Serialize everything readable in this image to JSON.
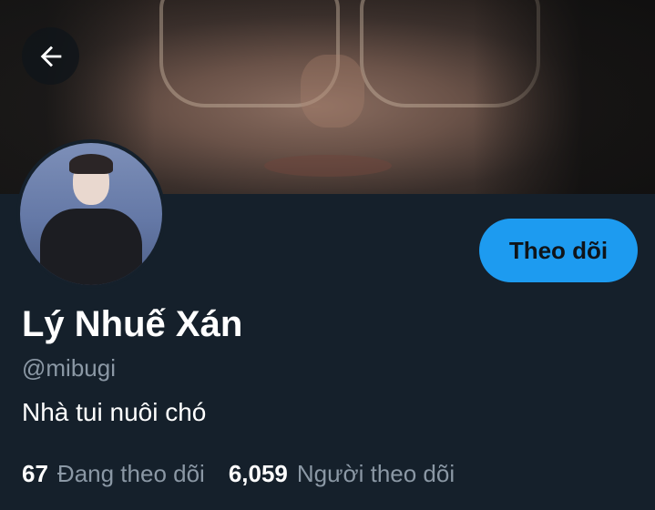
{
  "header": {
    "back_icon": "arrow-left-icon"
  },
  "profile": {
    "display_name": "Lý Nhuế Xán",
    "handle": "@mibugi",
    "bio": "Nhà tui nuôi chó",
    "follow_button_label": "Theo dõi"
  },
  "stats": {
    "following_count": "67",
    "following_label": "Đang theo dõi",
    "followers_count": "6,059",
    "followers_label": "Người theo dõi"
  },
  "colors": {
    "background": "#15202b",
    "accent": "#1d9bf0",
    "secondary_text": "#8b98a5",
    "primary_text": "#ffffff"
  }
}
